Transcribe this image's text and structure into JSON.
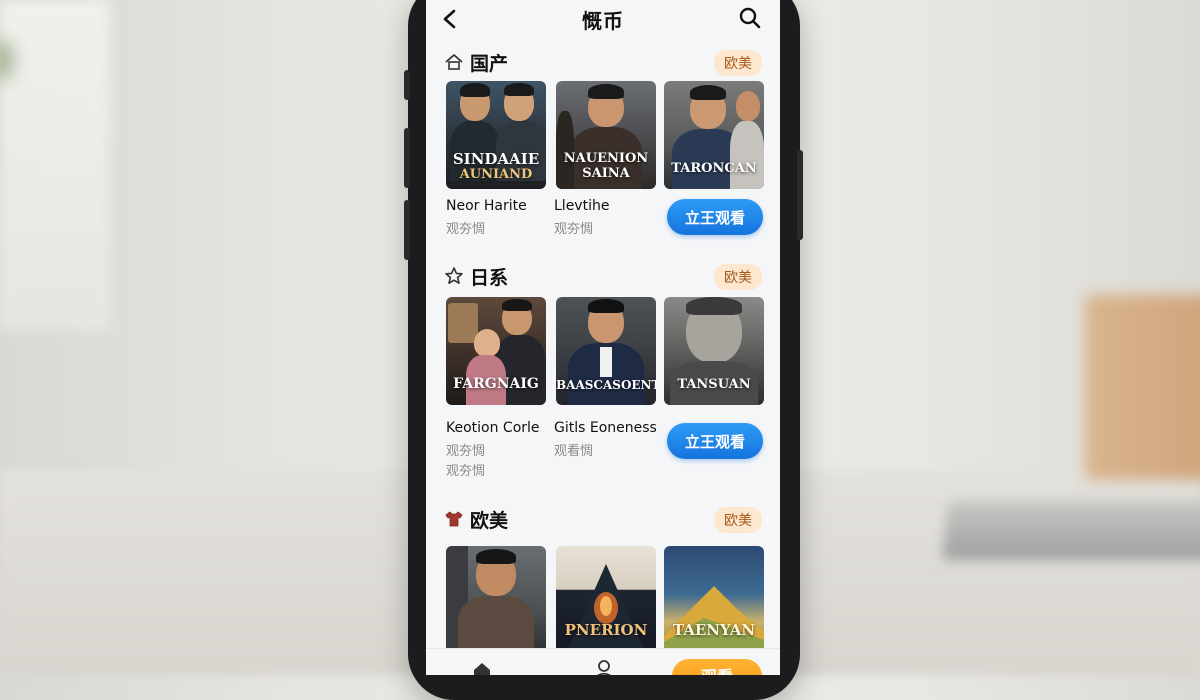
{
  "app": {
    "title": "慨币"
  },
  "sections": [
    {
      "title": "国产",
      "icon": "home-icon",
      "tag": "欧美",
      "posters": [
        {
          "title_line1": "SINDAAIE",
          "title_line2": "AUNIAND"
        },
        {
          "title_line1": "NAUENION",
          "title_line2": "SAINA"
        },
        {
          "title_line1": "TARONCAN",
          "title_line2": ""
        }
      ],
      "items": [
        {
          "title": "Neor Harite",
          "meta": "观夯惆"
        },
        {
          "title": "Llevtihe",
          "meta": "观夯惆"
        }
      ],
      "button": "立王观看"
    },
    {
      "title": "日系",
      "icon": "star-icon",
      "tag": "欧美",
      "posters": [
        {
          "title_line1": "FARGNAIG",
          "title_line2": ""
        },
        {
          "title_line1": "BAASCASOENT",
          "title_line2": ""
        },
        {
          "title_line1": "TANSUAN",
          "title_line2": ""
        }
      ],
      "items": [
        {
          "title": "Keotion Corle",
          "meta": "观夯惆",
          "meta2": "观夯惆"
        },
        {
          "title": "Gitls Eoneness",
          "meta": "观看惆"
        }
      ],
      "button": "立王观看"
    },
    {
      "title": "欧美",
      "icon": "shirt-icon",
      "tag": "欧美",
      "posters": [
        {
          "title_line1": "",
          "title_line2": ""
        },
        {
          "title_line1": "PNERION",
          "title_line2": ""
        },
        {
          "title_line1": "TAENYAN",
          "title_line2": ""
        }
      ]
    }
  ],
  "bottom_nav": {
    "cta": "观看"
  },
  "colors": {
    "accent_blue": "#1f86ee",
    "tag_bg": "#fde7cf",
    "cta_orange": "#f7a21a"
  }
}
